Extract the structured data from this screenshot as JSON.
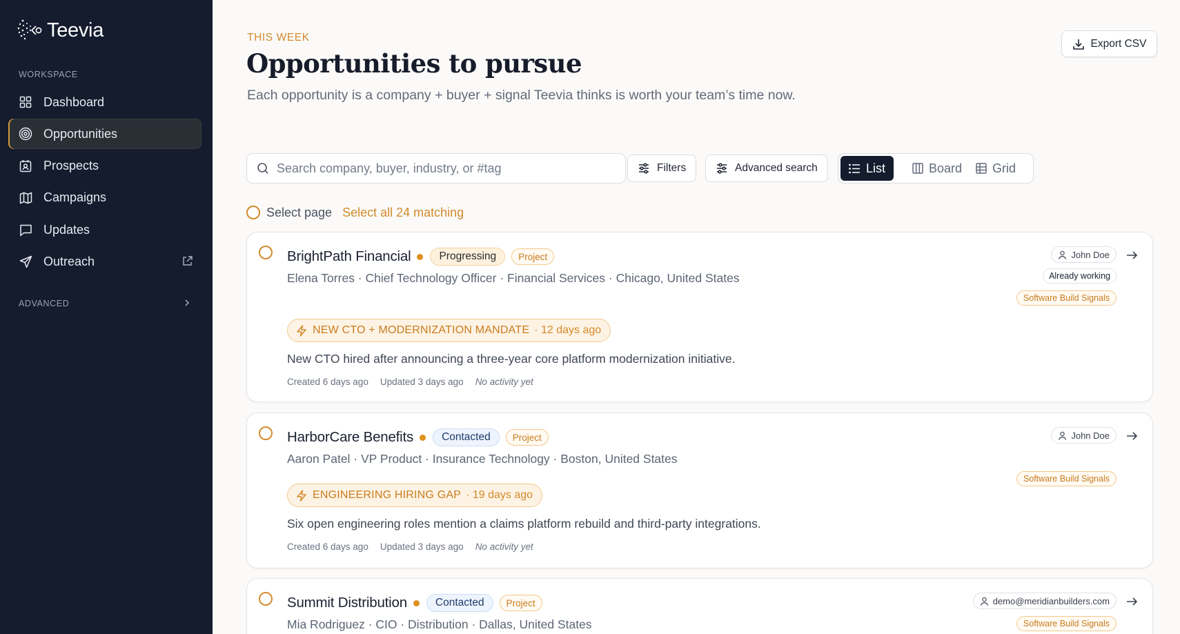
{
  "app": {
    "name": "Teevia"
  },
  "sidebar": {
    "workspace_label": "WORKSPACE",
    "items": [
      {
        "label": "Dashboard",
        "icon": "grid-icon"
      },
      {
        "label": "Opportunities",
        "icon": "target-icon",
        "active": true
      },
      {
        "label": "Prospects",
        "icon": "contact-card-icon"
      },
      {
        "label": "Campaigns",
        "icon": "map-icon"
      },
      {
        "label": "Updates",
        "icon": "message-square-icon"
      },
      {
        "label": "Outreach",
        "icon": "send-icon",
        "external": true
      }
    ],
    "advanced_label": "ADVANCED"
  },
  "header": {
    "eyebrow": "THIS WEEK",
    "title": "Opportunities to pursue",
    "subtitle": "Each opportunity is a company + buyer + signal Teevia thinks is worth your team’s time now.",
    "export_label": "Export CSV"
  },
  "toolbar": {
    "search_placeholder": "Search company, buyer, industry, or #tag",
    "search_value": "",
    "filters_label": "Filters",
    "advanced_label": "Advanced search",
    "views": [
      "List",
      "Board",
      "Grid"
    ],
    "active_view": "List"
  },
  "selection": {
    "select_page": "Select page",
    "select_all": "Select all 24 matching"
  },
  "opportunities": [
    {
      "company": "BrightPath Financial",
      "status": "Progressing",
      "type": "Project",
      "meta": "Elena Torres · Chief Technology Officer · Financial Services · Chicago, United States",
      "signal": "NEW CTO + MODERNIZATION MANDATE",
      "signal_age": "· 12 days ago",
      "description": "New CTO hired after announcing a three-year core platform modernization initiative.",
      "created": "Created 6 days ago",
      "updated": "Updated 3 days ago",
      "activity": "No activity yet",
      "owner": "John Doe",
      "badge": "Already working",
      "playbook": "Software Build Signals"
    },
    {
      "company": "HarborCare Benefits",
      "status": "Contacted",
      "type": "Project",
      "meta": "Aaron Patel · VP Product · Insurance Technology · Boston, United States",
      "signal": "ENGINEERING HIRING GAP",
      "signal_age": "· 19 days ago",
      "description": "Six open engineering roles mention a claims platform rebuild and third-party integrations.",
      "created": "Created 6 days ago",
      "updated": "Updated 3 days ago",
      "activity": "No activity yet",
      "owner": "John Doe",
      "playbook": "Software Build Signals"
    },
    {
      "company": "Summit Distribution",
      "status": "Contacted",
      "type": "Project",
      "meta": "Mia Rodriguez · CIO · Distribution · Dallas, United States",
      "owner": "demo@meridianbuilders.com",
      "playbook": "Software Build Signals"
    }
  ],
  "colors": {
    "sidebar_bg": "#141c2e",
    "accent": "#d28a2c",
    "contacted_bg": "#eef4fd",
    "progressing_bg": "#fdf1de"
  }
}
